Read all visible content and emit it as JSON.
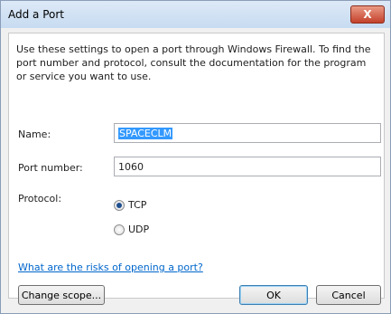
{
  "window": {
    "title": "Add a Port",
    "close_label": "X"
  },
  "description": "Use these settings to open a port through Windows Firewall. To find the port number and protocol, consult the documentation for the program or service you want to use.",
  "fields": {
    "name_label": "Name:",
    "name_value": "SPACECLM",
    "port_label": "Port number:",
    "port_value": "1060",
    "protocol_label": "Protocol:"
  },
  "protocol": {
    "options": [
      "TCP",
      "UDP"
    ],
    "selected": "TCP"
  },
  "link_text": "What are the risks of opening a port?",
  "buttons": {
    "change_scope": "Change scope...",
    "ok": "OK",
    "cancel": "Cancel"
  }
}
